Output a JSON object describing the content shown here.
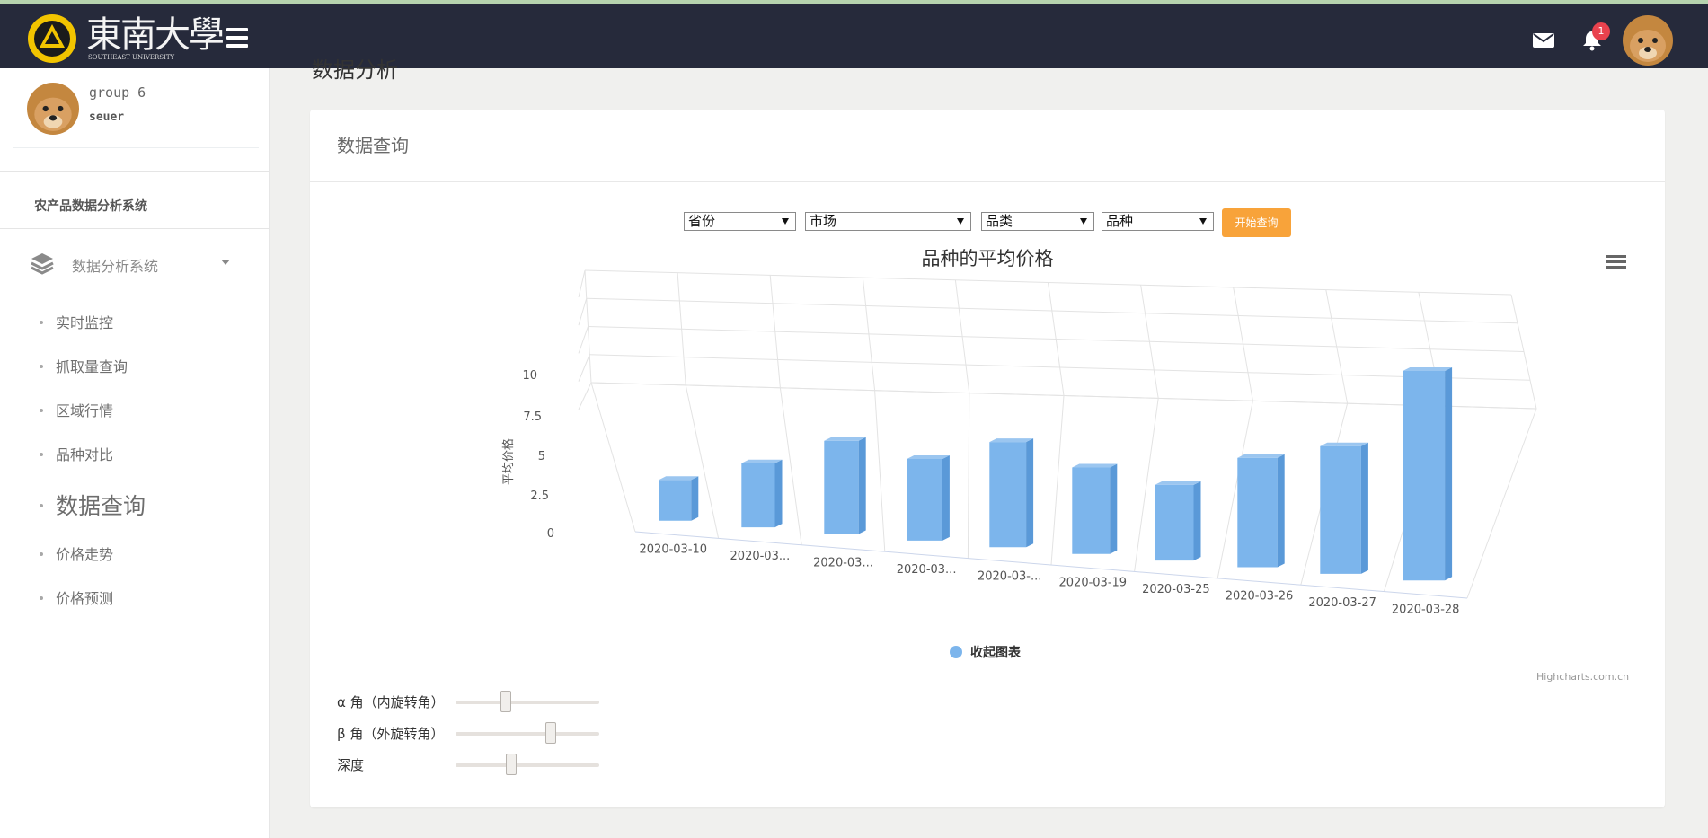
{
  "header": {
    "logo_text": "東南大學",
    "logo_subtitle": "SOUTHEAST UNIVERSITY",
    "notification_count": "1"
  },
  "sidebar": {
    "user_name": "group 6",
    "user_role": "seuer",
    "system_title": "农产品数据分析系统",
    "menu_label": "数据分析系统",
    "items": [
      {
        "label": "实时监控"
      },
      {
        "label": "抓取量查询"
      },
      {
        "label": "区域行情"
      },
      {
        "label": "品种对比"
      },
      {
        "label": "数据查询",
        "active": true
      },
      {
        "label": "价格走势"
      },
      {
        "label": "价格预测"
      }
    ]
  },
  "page": {
    "heading": "数据分析",
    "card_title": "数据查询"
  },
  "filters": {
    "province": "省份",
    "market": "市场",
    "category": "品类",
    "variety": "品种",
    "query_button": "开始查询"
  },
  "chart_data": {
    "type": "bar",
    "title": "品种的平均价格",
    "ylabel": "平均价格",
    "xlabel": "",
    "ylim": [
      0,
      10
    ],
    "yticks": [
      "0",
      "2.5",
      "5",
      "7.5",
      "10"
    ],
    "categories": [
      "2020-03-10",
      "2020-03...",
      "2020-03...",
      "2020-03...",
      "2020-03-...",
      "2020-03-19",
      "2020-03-25",
      "2020-03-26",
      "2020-03-27",
      "2020-03-28"
    ],
    "values": [
      2.6,
      4.0,
      5.7,
      4.9,
      6.2,
      5.0,
      4.3,
      6.1,
      7.0,
      11.3
    ],
    "legend": "收起图表",
    "credit": "Highcharts.com.cn",
    "bar_color": "#7cb5ec",
    "three_d": true
  },
  "controls": {
    "alpha_label": "α 角（内旋转角）",
    "beta_label": "β 角（外旋转角）",
    "depth_label": "深度",
    "alpha_value": 0.35,
    "beta_value": 0.66,
    "depth_value": 0.39
  }
}
